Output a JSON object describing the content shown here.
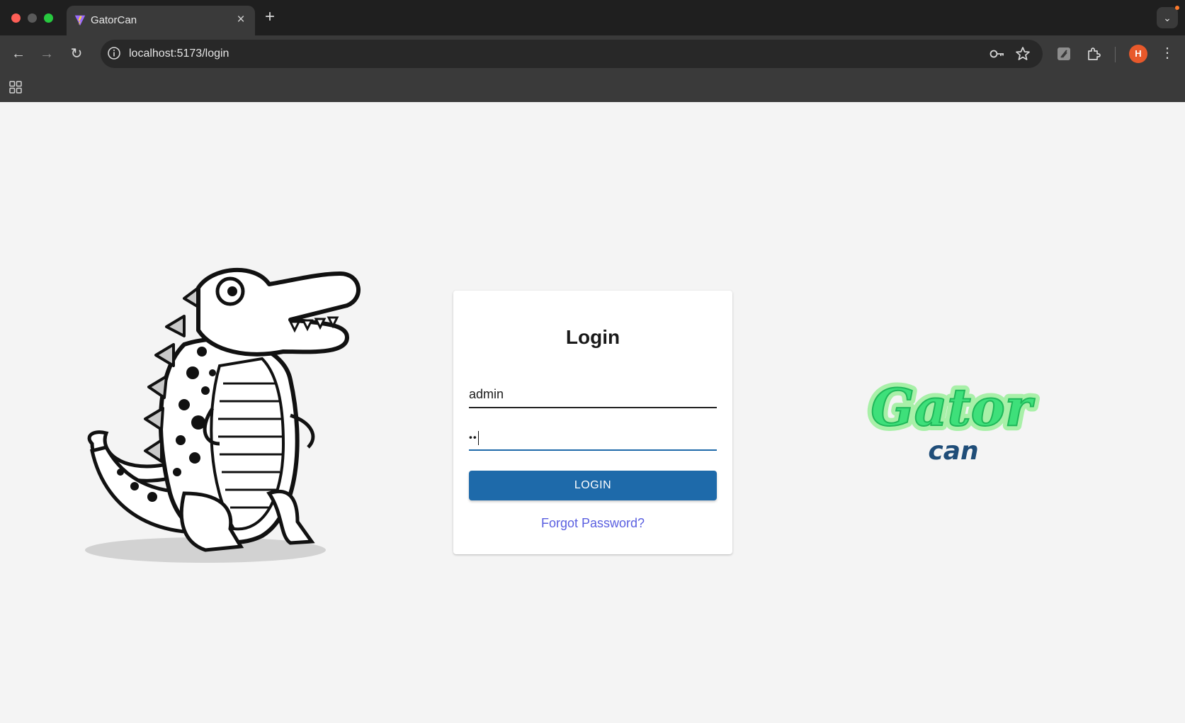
{
  "browser": {
    "tab_title": "GatorCan",
    "tab_close": "×",
    "new_tab": "+",
    "url": "localhost:5173/login",
    "profile_initial": "H",
    "colors": {
      "chrome_dark": "#1f1f1f",
      "toolbar": "#3a3a3a",
      "profile": "#e8592b"
    }
  },
  "login": {
    "title": "Login",
    "username_value": "admin",
    "password_mask": "••",
    "button_label": "LOGIN",
    "forgot_label": "Forgot Password?",
    "colors": {
      "primary": "#1e6aaa",
      "link": "#5a5fe0"
    }
  },
  "logo": {
    "word1": "Gator",
    "word2": "can",
    "colors": {
      "green": "#3ee07a",
      "navy": "#1f4d78"
    }
  }
}
